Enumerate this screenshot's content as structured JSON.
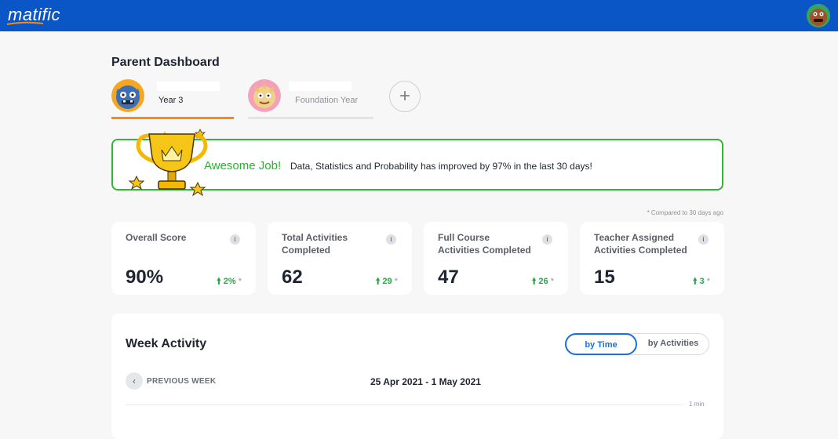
{
  "app": {
    "logo_text": "matific"
  },
  "colors": {
    "topbar": "#0b56c7",
    "success": "#36b339",
    "accent_orange": "#f28a1c",
    "toggle_active": "#1b6fd6"
  },
  "page": {
    "title": "Parent Dashboard"
  },
  "children": [
    {
      "name": "",
      "grade": "Year 3",
      "selected": true,
      "avatar": "blue-monster-avatar"
    },
    {
      "name": "",
      "grade": "Foundation Year",
      "selected": false,
      "avatar": "pink-monster-avatar"
    }
  ],
  "add_child": {
    "icon": "plus-icon",
    "glyph": "+"
  },
  "banner": {
    "headline": "Awesome Job!",
    "message": "Data, Statistics and Probability has improved by 97% in the last 30 days!",
    "icon": "trophy-icon"
  },
  "compared_note": "* Compared to 30 days ago",
  "stats": [
    {
      "label": "Overall Score",
      "value": "90%",
      "delta": "2%",
      "delta_mark": "*"
    },
    {
      "label": "Total Activities Completed",
      "value": "62",
      "delta": "29",
      "delta_mark": "*"
    },
    {
      "label": "Full Course Activities Completed",
      "value": "47",
      "delta": "26",
      "delta_mark": "*"
    },
    {
      "label": "Teacher Assigned Activities Completed",
      "value": "15",
      "delta": "3",
      "delta_mark": "*"
    }
  ],
  "info_glyph": "i",
  "week_activity": {
    "title": "Week Activity",
    "toggle": {
      "by_time": "by Time",
      "by_activities": "by Activities",
      "selected": "by_time"
    },
    "prev_week_label": "PREVIOUS WEEK",
    "range": "25 Apr 2021 - 1 May 2021",
    "axis_label": "1 min"
  }
}
